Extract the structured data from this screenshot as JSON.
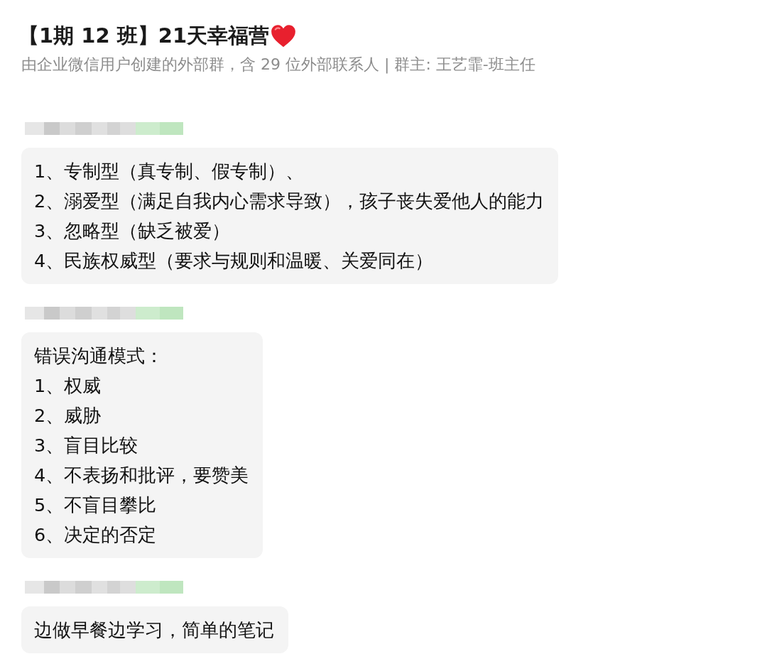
{
  "header": {
    "title": "【1期 12 班】21天幸福营",
    "subtitle": "由企业微信用户创建的外部群，含 29 位外部联系人 | 群主: 王艺霏-班主任"
  },
  "messages": [
    {
      "lines": [
        "1、专制型（真专制、假专制）、",
        "2、溺爱型（满足自我内心需求导致），孩子丧失爱他人的能力",
        "3、忽略型（缺乏被爱）",
        "4、民族权威型（要求与规则和温暖、关爱同在）"
      ]
    },
    {
      "lines": [
        "错误沟通模式：",
        "1、权威",
        "2、威胁",
        "3、盲目比较",
        "4、不表扬和批评，要赞美",
        "5、不盲目攀比",
        "6、决定的否定"
      ]
    },
    {
      "lines": [
        "边做早餐边学习，简单的笔记"
      ]
    }
  ]
}
